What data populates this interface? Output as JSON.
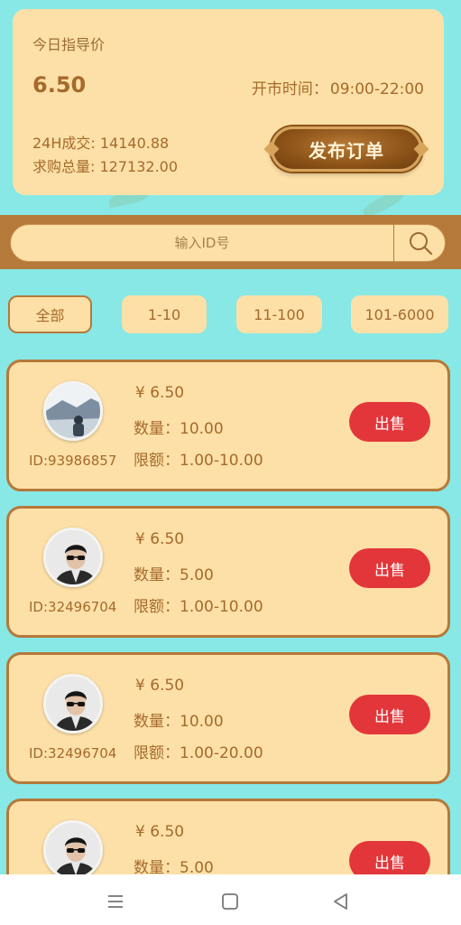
{
  "header": {
    "title": "今日指导价",
    "price": "6.50",
    "hours_label": "开市时间：",
    "hours_value": "09:00-22:00",
    "volume_label": "24H成交: ",
    "volume_value": "14140.88",
    "total_label": "求购总量: ",
    "total_value": "127132.00",
    "publish_button": "发布订单"
  },
  "search": {
    "placeholder": "输入ID号",
    "icon": "search-icon"
  },
  "tabs": [
    {
      "label": "全部",
      "active": true
    },
    {
      "label": "1-10",
      "active": false
    },
    {
      "label": "11-100",
      "active": false
    },
    {
      "label": "101-6000",
      "active": false
    }
  ],
  "orders": [
    {
      "user_id": "ID:93986857",
      "price": "¥ 6.50",
      "qty_label": "数量：",
      "qty": "10.00",
      "limit_label": "限额：",
      "limit": "1.00-10.00",
      "button": "出售"
    },
    {
      "user_id": "ID:32496704",
      "price": "¥ 6.50",
      "qty_label": "数量：",
      "qty": "5.00",
      "limit_label": "限额：",
      "limit": "1.00-10.00",
      "button": "出售"
    },
    {
      "user_id": "ID:32496704",
      "price": "¥ 6.50",
      "qty_label": "数量：",
      "qty": "10.00",
      "limit_label": "限额：",
      "limit": "1.00-20.00",
      "button": "出售"
    },
    {
      "user_id": "",
      "price": "¥ 6.50",
      "qty_label": "数量：",
      "qty": "5.00",
      "limit_label": "",
      "limit": "",
      "button": "出售"
    }
  ],
  "nav": {
    "icons": [
      "menu-icon",
      "home-square-icon",
      "back-triangle-icon"
    ]
  },
  "colors": {
    "background": "#87e8e6",
    "card": "#fde0a7",
    "brown": "#b5793a",
    "text": "#a56a2c",
    "sell_red": "#e3363a"
  }
}
